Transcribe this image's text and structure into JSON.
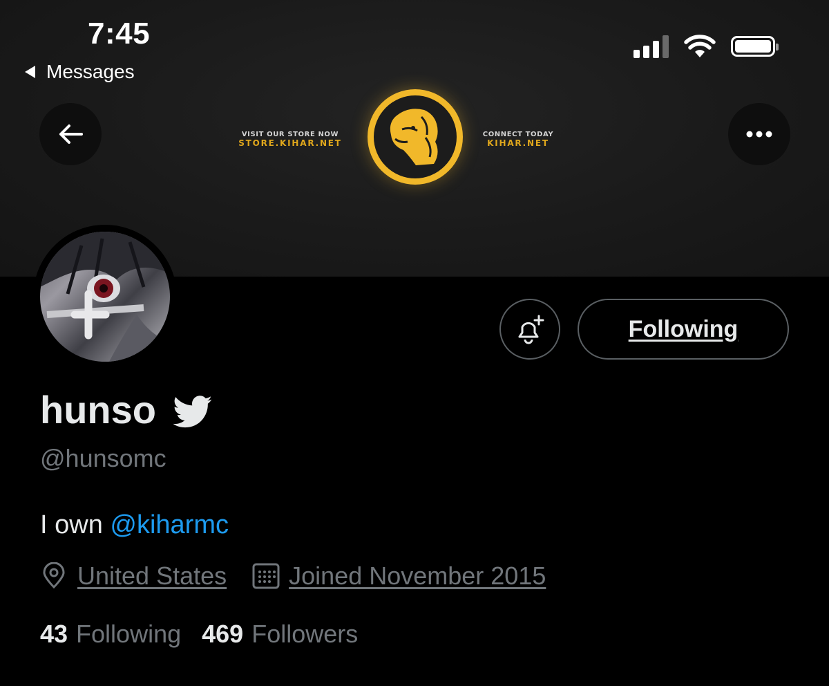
{
  "status_bar": {
    "time": "7:45",
    "back_label": "Messages"
  },
  "banner": {
    "left_small": "VISIT OUR STORE NOW",
    "left_gold": "STORE.KIHAR.NET",
    "right_small": "CONNECT TODAY",
    "right_gold": "KIHAR.NET",
    "logo_icon": "lion-head-icon",
    "accent_color": "#f1b82a"
  },
  "header": {
    "back_icon": "arrow-left-icon",
    "more_icon": "more-horizontal-icon"
  },
  "actions": {
    "notify_icon": "bell-plus-icon",
    "following_label": "Following"
  },
  "profile": {
    "display_name": "hunso",
    "verified_icon": "twitter-bird-icon",
    "handle": "@hunsomc",
    "bio_prefix": "I own ",
    "bio_mention": "@kiharmc",
    "location": "United States",
    "joined": "Joined November 2015",
    "following_count": "43",
    "following_label": "Following",
    "followers_count": "469",
    "followers_label": "Followers"
  },
  "colors": {
    "background": "#000000",
    "text": "#e7e9ea",
    "secondary": "#71767b",
    "link": "#1d9bf0"
  }
}
